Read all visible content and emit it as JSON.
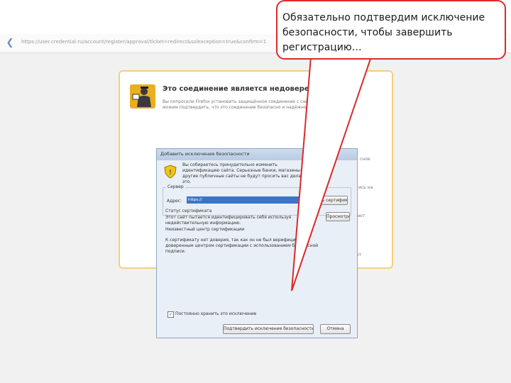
{
  "browser": {
    "url": "https://user.credential.ru/account/register/approval/ticket=redirect&sslexception=true&confirm=1",
    "back_icon": "back-arrow-icon"
  },
  "warning_page": {
    "title": "Это соединение является недоверенным",
    "body": "Вы попросили Firefox установить защищённое соединение с сайтом, но мы не можем подтвердить, что это соединение безопасно и надёжно.",
    "side_fragments": [
      "сное",
      "ись на",
      "ают",
      "ет"
    ]
  },
  "dialog": {
    "title": "Добавить исключение безопасности",
    "intro": "Вы собираетесь принудительно изменить идентификацию сайта. Серьезные банки, магазины и другие публичные сайты не будут просить вас делать это.",
    "server_legend": "Сервер",
    "address_label": "Адрес:",
    "address_value": "https://",
    "get_cert_label": "Получить сертификат",
    "cert_legend": "Статус сертификата",
    "cert_text_1": "Этот сайт пытается идентифицировать себя используя недействительную информацию.",
    "cert_text_2": "Неизвестный центр сертификации",
    "cert_text_3": "К сертификату нет доверия, так как он не был верифицирован доверенным центром сертификации с использованием безопасной подписи.",
    "view_label": "Просмотреть...",
    "permanent_label": "Постоянно хранить это исключение",
    "permanent_checked": true,
    "confirm_label": "Подтвердить исключение безопасности",
    "cancel_label": "Отмена"
  },
  "callout": {
    "text": "Обязательно подтвердим исключение безопасности, чтобы завершить регистрацию…",
    "border_color": "#d92a2a"
  }
}
